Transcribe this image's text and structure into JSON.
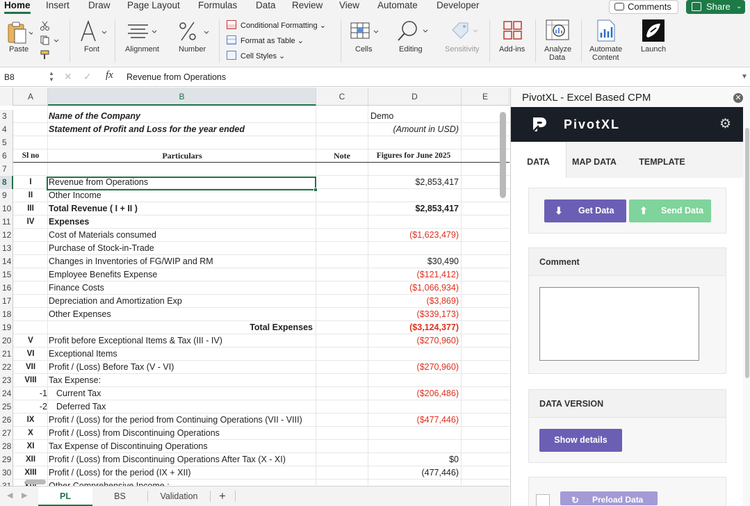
{
  "menu": {
    "tabs": [
      "Home",
      "Insert",
      "Draw",
      "Page Layout",
      "Formulas",
      "Data",
      "Review",
      "View",
      "Automate",
      "Developer"
    ],
    "active": "Home",
    "comments_label": "Comments",
    "share_label": "Share"
  },
  "ribbon": {
    "paste": "Paste",
    "font": "Font",
    "alignment": "Alignment",
    "number": "Number",
    "conditional_formatting": "Conditional Formatting",
    "format_as_table": "Format as Table",
    "cell_styles": "Cell Styles",
    "cells": "Cells",
    "editing": "Editing",
    "sensitivity": "Sensitivity",
    "add_ins": "Add-ins",
    "analyze_data_1": "Analyze",
    "analyze_data_2": "Data",
    "automate_content_1": "Automate",
    "automate_content_2": "Content",
    "launch": "Launch"
  },
  "formula_bar": {
    "cell_ref": "B8",
    "fx": "fx",
    "content": "Revenue from Operations"
  },
  "columns": [
    "A",
    "B",
    "C",
    "D",
    "E"
  ],
  "rows": [
    {
      "n": "3",
      "a": "",
      "b": "Name of the Company",
      "b_style": "bi",
      "c": "",
      "d": "Demo",
      "d_style": "left"
    },
    {
      "n": "4",
      "a": "",
      "b": "Statement of Profit and Loss for the year ended",
      "b_style": "bi",
      "c": "",
      "d": "(Amount in USD)",
      "d_style": "i"
    },
    {
      "n": "5",
      "a": "",
      "b": "",
      "c": "",
      "d": ""
    },
    {
      "n": "6",
      "a": "Sl no",
      "b": "Particulars",
      "b_style": "hdr",
      "c": "Note",
      "d": "Figures for June 2025",
      "d_style": "hdr"
    },
    {
      "n": "7",
      "a": "",
      "b": "",
      "c": "",
      "d": ""
    },
    {
      "n": "8",
      "a": "I",
      "b": "Revenue from Operations",
      "c": "",
      "d": "$2,853,417"
    },
    {
      "n": "9",
      "a": "II",
      "b": "Other Income",
      "c": "",
      "d": ""
    },
    {
      "n": "10",
      "a": "III",
      "b": "Total Revenue ( I + II )",
      "b_style": "b",
      "c": "",
      "d": "$2,853,417",
      "d_style": "b"
    },
    {
      "n": "11",
      "a": "IV",
      "b": "Expenses",
      "b_style": "b",
      "c": "",
      "d": ""
    },
    {
      "n": "12",
      "a": "",
      "b": "Cost of Materials consumed",
      "c": "",
      "d": "($1,623,479)",
      "d_style": "neg"
    },
    {
      "n": "13",
      "a": "",
      "b": "Purchase of Stock-in-Trade",
      "c": "",
      "d": ""
    },
    {
      "n": "14",
      "a": "",
      "b": "Changes in Inventories of FG/WIP and RM",
      "c": "",
      "d": "$30,490"
    },
    {
      "n": "15",
      "a": "",
      "b": "Employee Benefits Expense",
      "c": "",
      "d": "($121,412)",
      "d_style": "neg"
    },
    {
      "n": "16",
      "a": "",
      "b": "Finance Costs",
      "c": "",
      "d": "($1,066,934)",
      "d_style": "neg"
    },
    {
      "n": "17",
      "a": "",
      "b": "Depreciation and Amortization Exp",
      "c": "",
      "d": "($3,869)",
      "d_style": "neg"
    },
    {
      "n": "18",
      "a": "",
      "b": "Other Expenses",
      "c": "",
      "d": "($339,173)",
      "d_style": "neg"
    },
    {
      "n": "19",
      "a": "",
      "b": "Total Expenses",
      "b_style": "br",
      "c": "",
      "d": "($3,124,377)",
      "d_style": "negb"
    },
    {
      "n": "20",
      "a": "V",
      "b": "Profit before Exceptional Items & Tax (III - IV)",
      "c": "",
      "d": "($270,960)",
      "d_style": "neg"
    },
    {
      "n": "21",
      "a": "VI",
      "b": "Exceptional Items",
      "c": "",
      "d": ""
    },
    {
      "n": "22",
      "a": "VII",
      "b": "Profit / (Loss) Before Tax (V - VI)",
      "c": "",
      "d": "($270,960)",
      "d_style": "neg"
    },
    {
      "n": "23",
      "a": "VIII",
      "b": "Tax Expense:",
      "c": "",
      "d": ""
    },
    {
      "n": "24",
      "a": "-1",
      "a_style": "num",
      "b": "Current Tax",
      "b_style": "indent",
      "c": "",
      "d": "($206,486)",
      "d_style": "neg"
    },
    {
      "n": "25",
      "a": "-2",
      "a_style": "num",
      "b": "Deferred Tax",
      "b_style": "indent",
      "c": "",
      "d": ""
    },
    {
      "n": "26",
      "a": "IX",
      "b": "Profit / (Loss) for the period from Continuing Operations (VII - VIII)",
      "c": "",
      "d": "($477,446)",
      "d_style": "neg"
    },
    {
      "n": "27",
      "a": "X",
      "b": "Profit / (Loss) from Discontinuing Operations",
      "c": "",
      "d": ""
    },
    {
      "n": "28",
      "a": "XI",
      "b": "Tax Expense of Discontinuing Operations",
      "c": "",
      "d": ""
    },
    {
      "n": "29",
      "a": "XII",
      "b": "Profit / (Loss)  from Discontinuing Operations After Tax (X - XI)",
      "c": "",
      "d": "$0"
    },
    {
      "n": "30",
      "a": "XIII",
      "b": "Profit / (Loss) for the period (IX + XII)",
      "c": "",
      "d": "(477,446)"
    },
    {
      "n": "31",
      "a": "XIV",
      "b": "Other Comprehensive Income :",
      "c": "",
      "d": ""
    }
  ],
  "sheet_tabs": [
    "PL",
    "BS",
    "Validation"
  ],
  "active_sheet": "PL",
  "add_sheet": "+",
  "pane": {
    "title": "PivotXL - Excel Based CPM",
    "brand_name": "PivotXL",
    "tabs": [
      "DATA",
      "MAP DATA",
      "TEMPLATE"
    ],
    "active_tab": "DATA",
    "get_data": "Get Data",
    "send_data": "Send Data",
    "comment_label": "Comment",
    "comment_value": "",
    "data_version_label": "DATA VERSION",
    "show_details": "Show details",
    "preload_data": "Preload Data"
  },
  "colors": {
    "excel_green": "#217346",
    "share_green": "#1d7a47",
    "negative_red": "#e0301e",
    "pivot_purple": "#6b5fb5",
    "send_green": "#7ed49a",
    "brand_dark": "#1a1e27"
  }
}
